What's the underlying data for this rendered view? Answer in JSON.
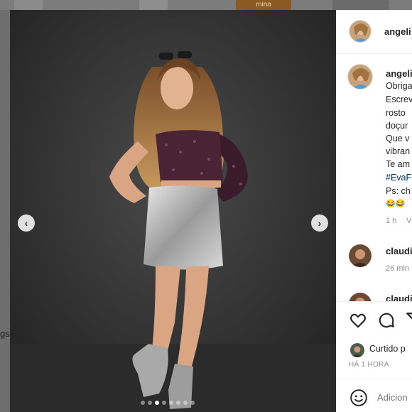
{
  "background": {
    "partial_text": "gs",
    "tile_label": "mina"
  },
  "photo": {
    "prev_icon": "chevron-left-icon",
    "next_icon": "chevron-right-icon",
    "carousel": {
      "total": 8,
      "active": 2
    }
  },
  "panel": {
    "header": {
      "username": "angeli"
    },
    "caption": {
      "username": "angeli",
      "lines": [
        "Obriga",
        "Escrev",
        "rosto",
        "doçur",
        "Que v",
        "vibran",
        "Te am"
      ],
      "hashtag": "#EvaF",
      "ps": "Ps: ch",
      "emoji": "😂😂",
      "time": "1 h",
      "extra": "V"
    },
    "comments": [
      {
        "username": "claudi",
        "time": "26 min"
      },
      {
        "username": "claudi",
        "time": ""
      }
    ],
    "actions": {
      "like_icon": "heart-icon",
      "comment_icon": "comment-icon",
      "share_icon": "share-icon"
    },
    "liked_by": "Curtido p",
    "post_time": "HÁ 1 HORA",
    "comment_placeholder": "Adicion",
    "emoji_icon": "smile-icon"
  },
  "colors": {
    "hashtag": "#00376b",
    "muted": "#8e8e8e",
    "text": "#262626"
  }
}
